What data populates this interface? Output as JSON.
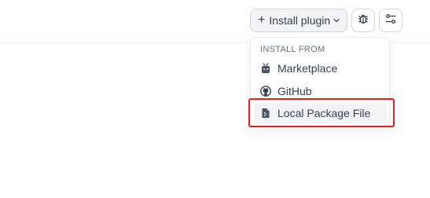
{
  "toolbar": {
    "install_plugin_label": "Install plugin",
    "plus_glyph": "+",
    "icons": [
      "plus-icon",
      "chevron-down-icon",
      "debug-bug-icon",
      "settings-sliders-icon"
    ]
  },
  "dropdown": {
    "section_label": "INSTALL FROM",
    "items": [
      {
        "label": "Marketplace",
        "icon": "marketplace-icon"
      },
      {
        "label": "GitHub",
        "icon": "github-icon"
      },
      {
        "label": "Local Package File",
        "icon": "package-file-icon",
        "hovered": true
      }
    ]
  },
  "colors": {
    "highlight_box": "#e5221d",
    "text": "#344054",
    "muted": "#667085",
    "hover_bg": "#f2f4f7"
  }
}
